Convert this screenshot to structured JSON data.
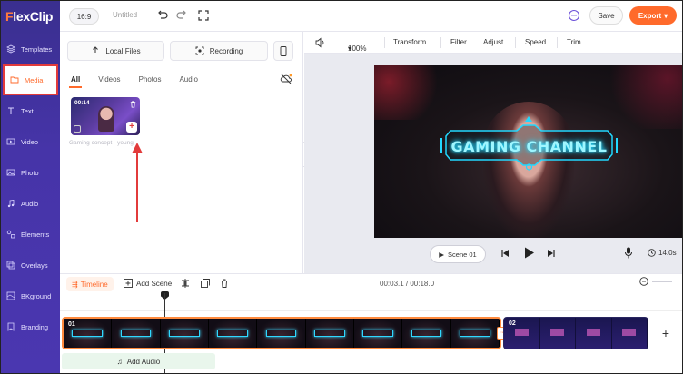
{
  "app": {
    "logo_prefix": "F",
    "logo_rest": "lexClip"
  },
  "sidebar": {
    "items": [
      {
        "label": "Templates",
        "icon": "layers-icon"
      },
      {
        "label": "Media",
        "icon": "folder-icon",
        "active": true
      },
      {
        "label": "Text",
        "icon": "text-icon"
      },
      {
        "label": "Video",
        "icon": "video-icon"
      },
      {
        "label": "Photo",
        "icon": "photo-icon"
      },
      {
        "label": "Audio",
        "icon": "music-icon"
      },
      {
        "label": "Elements",
        "icon": "elements-icon"
      },
      {
        "label": "Overlays",
        "icon": "overlays-icon"
      },
      {
        "label": "BKground",
        "icon": "background-icon"
      },
      {
        "label": "Branding",
        "icon": "branding-icon"
      }
    ]
  },
  "topbar": {
    "ratio": "16:9",
    "project_title": "Untitled",
    "save_label": "Save",
    "export_label": "Export"
  },
  "media_panel": {
    "local_files_label": "Local Files",
    "recording_label": "Recording",
    "tabs": [
      "All",
      "Videos",
      "Photos",
      "Audio"
    ],
    "active_tab": "All",
    "items": [
      {
        "duration": "00:14",
        "caption": "Gaming concept - young"
      }
    ]
  },
  "editor_toolbar": {
    "zoom": "100%",
    "items": [
      "Transform",
      "Filter",
      "Adjust",
      "Speed",
      "Trim"
    ]
  },
  "preview": {
    "banner_text": "GAMING CHANNEL",
    "scene_label": "Scene  01",
    "duration": "14.0s"
  },
  "timeline": {
    "tab_label": "Timeline",
    "add_scene_label": "Add Scene",
    "time_display": "00:03.1 / 00:18.0",
    "clips": [
      {
        "label": "01",
        "frames": 9
      },
      {
        "label": "02",
        "frames": 4
      }
    ],
    "add_audio_label": "Add Audio"
  },
  "colors": {
    "accent": "#ff6a2b",
    "sidebar": "#4634a8",
    "highlight_box": "#e23b3b",
    "neon": "#22d8ff"
  }
}
